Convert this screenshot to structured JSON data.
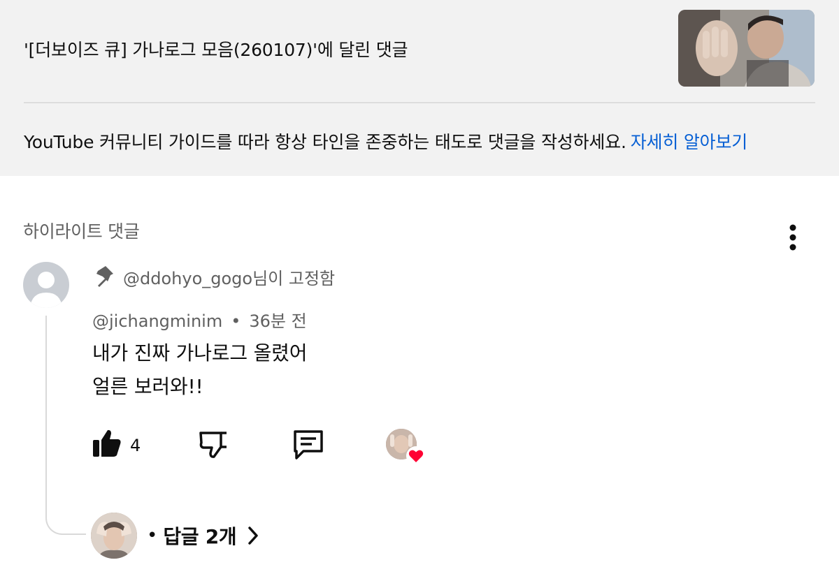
{
  "header": {
    "video_title": "'[더보이즈 큐] 가나로그 모음(260107)'에 달린 댓글",
    "guidelines_text": "YouTube 커뮤니티 가이드를 따라 항상 타인을 존중하는 태도로 댓글을 작성하세요.",
    "learn_more_link": "자세히 알아보기"
  },
  "section": {
    "title": "하이라이트 댓글"
  },
  "comment": {
    "pinned_by": "@ddohyo_gogo님이 고정함",
    "author": "@jichangminim",
    "separator": "•",
    "time": "36분 전",
    "lines": [
      "내가 진짜 가나로그 올렸어",
      "얼른 보러와!!"
    ],
    "like_count": "4"
  },
  "replies": {
    "separator": "•",
    "label": "답글 2개"
  },
  "colors": {
    "panel_background": "#f2f2f2",
    "link": "#065fd4",
    "secondary_text": "#606060",
    "heart": "#ff0033"
  },
  "icons": {
    "pin": "pin-icon",
    "more": "more-vertical-icon",
    "like": "thumbs-up-filled-icon",
    "dislike": "thumbs-down-icon",
    "reply": "comment-icon",
    "heart": "heart-icon",
    "chevron": "chevron-right-icon"
  }
}
